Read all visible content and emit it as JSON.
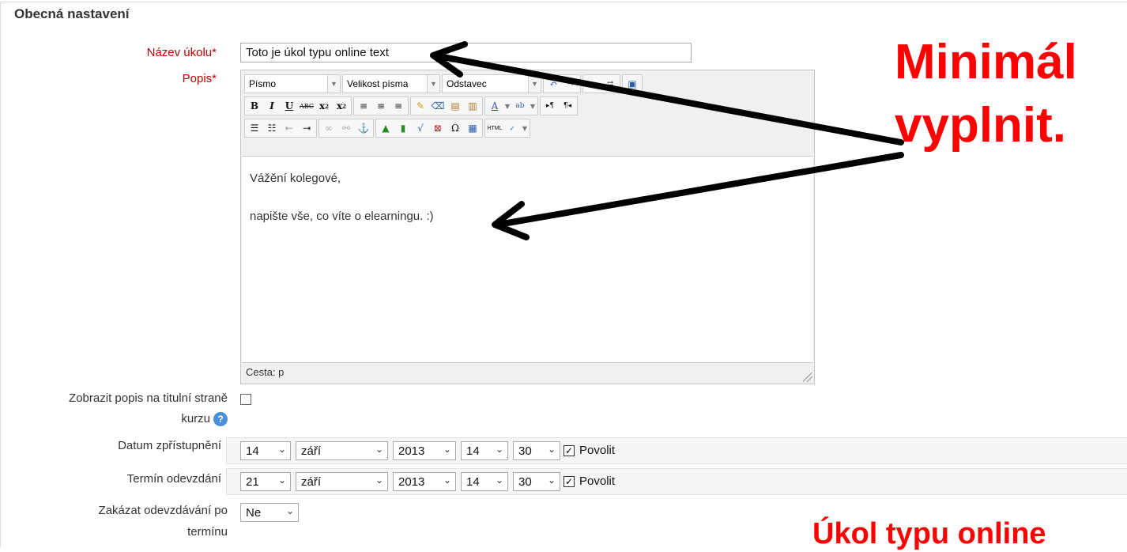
{
  "legend": "Obecná nastavení",
  "name_field": {
    "label": "Název úkolu",
    "value": "Toto je úkol typu online text"
  },
  "description": {
    "label": "Popis",
    "toolbar": {
      "font_select": "Písmo",
      "size_select": "Velikost písma",
      "format_select": "Odstavec"
    },
    "content": [
      "Vážění kolegové,",
      "napište vše, co víte o elearningu. :)"
    ],
    "path": "Cesta: p"
  },
  "show_description": {
    "label_line1": "Zobrazit popis na titulní straně",
    "label_line2": "kurzu"
  },
  "available_from": {
    "label": "Datum zpřístupnění",
    "day": "14",
    "month": "září",
    "year": "2013",
    "hour": "14",
    "minute": "30",
    "enable": "Povolit"
  },
  "due_date": {
    "label": "Termín odevzdání",
    "day": "21",
    "month": "září",
    "year": "2013",
    "hour": "14",
    "minute": "30",
    "enable": "Povolit"
  },
  "prevent_late": {
    "label_line1": "Zakázat odevzdávání po",
    "label_line2": "termínu",
    "value": "Ne"
  },
  "overlay": {
    "line1": "Minimál",
    "line2": "vyplnit.",
    "bottom": "Úkol typu online",
    "color": "#ff0000"
  }
}
